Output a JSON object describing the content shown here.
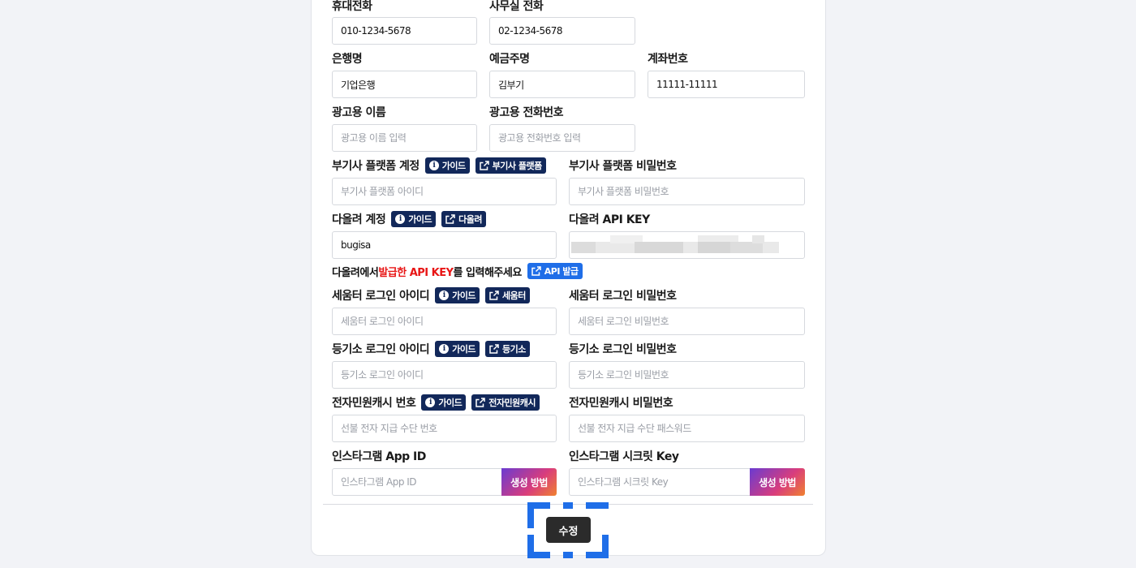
{
  "fields": {
    "mobile": {
      "label": "휴대전화",
      "value": "010-1234-5678"
    },
    "office": {
      "label": "사무실 전화",
      "value": "02-1234-5678"
    },
    "bank": {
      "label": "은행명",
      "value": "기업은행"
    },
    "holder": {
      "label": "예금주명",
      "value": "김부기"
    },
    "account": {
      "label": "계좌번호",
      "value": "11111-11111"
    },
    "ad_name": {
      "label": "광고용 이름",
      "placeholder": "광고용 이름 입력"
    },
    "ad_phone": {
      "label": "광고용 전화번호",
      "placeholder": "광고용 전화번호 입력"
    },
    "platform_id": {
      "label": "부기사 플랫폼 계정",
      "placeholder": "부기사 플랫폼 아이디",
      "guide": "가이드",
      "link": "부기사 플랫폼"
    },
    "platform_pw": {
      "label": "부기사 플랫폼 비밀번호",
      "placeholder": "부기사 플랫폼 비밀번호"
    },
    "daol_id": {
      "label": "다올려 계정",
      "value": "bugisa",
      "guide": "가이드",
      "link": "다올려"
    },
    "daol_key": {
      "label": "다올려 API KEY"
    },
    "daol_note": {
      "pre": "다올려에서 ",
      "highlight": "발급한 API KEY",
      "post": "를 입력해주세요",
      "link": "API 발급"
    },
    "seumteo_id": {
      "label": "세움터 로그인 아이디",
      "placeholder": "세움터 로그인 아이디",
      "guide": "가이드",
      "link": "세움터"
    },
    "seumteo_pw": {
      "label": "세움터 로그인 비밀번호",
      "placeholder": "세움터 로그인 비밀번호"
    },
    "registry_id": {
      "label": "등기소 로그인 아이디",
      "placeholder": "등기소 로그인 아이디",
      "guide": "가이드",
      "link": "등기소"
    },
    "registry_pw": {
      "label": "등기소 로그인 비밀번호",
      "placeholder": "등기소 로그인 비밀번호"
    },
    "ecash_no": {
      "label": "전자민원캐시 번호",
      "placeholder": "선불 전자 지급 수단 번호",
      "guide": "가이드",
      "link": "전자민원캐시"
    },
    "ecash_pw": {
      "label": "전자민원캐시 비밀번호",
      "placeholder": "선불 전자 지급 수단 패스워드"
    },
    "insta_id": {
      "label": "인스타그램 App ID",
      "placeholder": "인스타그램 App ID",
      "button": "생성 방법"
    },
    "insta_key": {
      "label": "인스타그램 시크릿 Key",
      "placeholder": "인스타그램 시크릿 Key",
      "button": "생성 방법"
    }
  },
  "submit_label": "수정",
  "colors": {
    "badge": "#12285a",
    "badge_blue": "#1f6ee8",
    "highlight": "#e81515",
    "submit": "#2b2b2b",
    "focus": "#1f6ee8"
  }
}
